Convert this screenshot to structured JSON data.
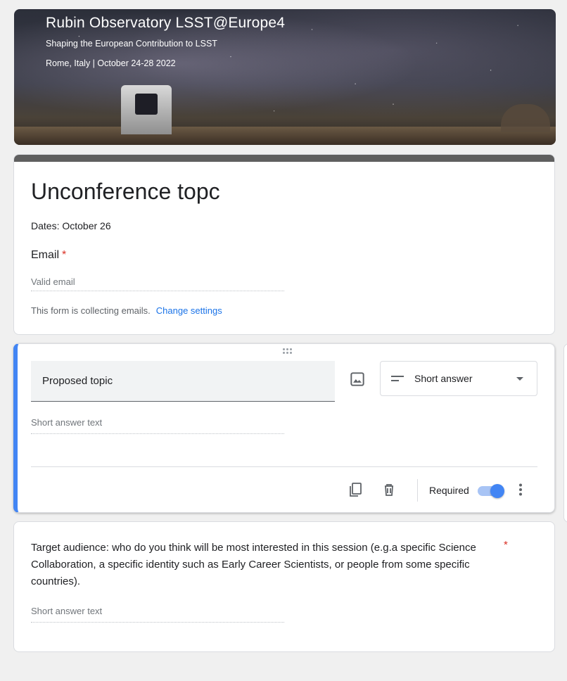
{
  "banner": {
    "title": "Rubin Observatory LSST@Europe4",
    "subtitle": "Shaping the European Contribution to LSST",
    "location": "Rome, Italy | October 24-28 2022"
  },
  "form": {
    "title": "Unconference topc",
    "description": "Dates: October 26",
    "email_label": "Email",
    "required_mark": "*",
    "email_placeholder": "Valid email",
    "collect_note": "This form is collecting emails.",
    "change_settings": "Change settings"
  },
  "question1": {
    "title": "Proposed topic",
    "type": "Short answer",
    "answer_placeholder": "Short answer text",
    "required_label": "Required",
    "required": true
  },
  "question2": {
    "title": "Target audience: who do you think will be most interested in this session (e.g.a specific Science Collaboration, a specific identity such as Early Career Scientists, or people from some specific countries).",
    "required_mark": "*",
    "answer_placeholder": "Short answer text"
  },
  "colors": {
    "accent": "#4285f4",
    "header_bar": "#5f5f5f",
    "required": "#d93025",
    "link": "#1a73e8"
  },
  "icons": [
    "drag-handle-icon",
    "image-icon",
    "short-answer-icon",
    "dropdown-caret-icon",
    "copy-icon",
    "trash-icon",
    "more-vert-icon"
  ]
}
